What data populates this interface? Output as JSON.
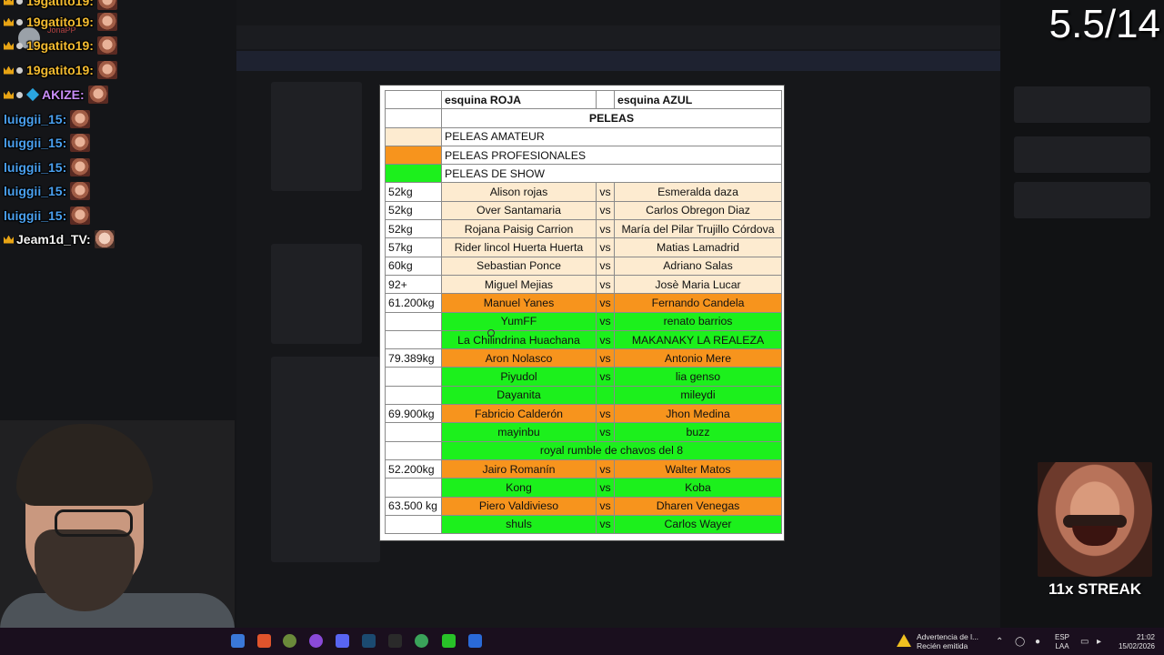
{
  "counter": "5.5/14",
  "chat": [
    {
      "user": "19gatito19:",
      "color": "gold",
      "badges": [
        "crown"
      ]
    },
    {
      "user": "19gatito19:",
      "color": "gold",
      "badges": [
        "crown",
        "dot"
      ],
      "tag": "JonaPP"
    },
    {
      "user": "19gatito19:",
      "color": "gold",
      "badges": [
        "crown",
        "dot"
      ]
    },
    {
      "user": "AKIZE:",
      "color": "purple",
      "badges": [
        "crown",
        "dot",
        "gem"
      ]
    },
    {
      "user": "luiggii_15:",
      "color": "blue",
      "badges": []
    },
    {
      "user": "luiggii_15:",
      "color": "blue",
      "badges": []
    },
    {
      "user": "luiggii_15:",
      "color": "blue",
      "badges": []
    },
    {
      "user": "luiggii_15:",
      "color": "blue",
      "badges": []
    },
    {
      "user": "luiggii_15:",
      "color": "blue",
      "badges": []
    },
    {
      "user": "Jeam1d_TV:",
      "color": "white",
      "badges": [
        "crown"
      ]
    }
  ],
  "sheet": {
    "header": {
      "red": "esquina ROJA",
      "blue": "esquina AZUL"
    },
    "title": "PELEAS",
    "legend": [
      "PELEAS AMATEUR",
      "PELEAS PROFESIONALES",
      "PELEAS DE SHOW"
    ],
    "rows": [
      {
        "w": "52kg",
        "a": "Alison rojas",
        "vs": "vs",
        "b": "Esmeralda daza",
        "type": "am"
      },
      {
        "w": "52kg",
        "a": "Over Santamaria",
        "vs": "vs",
        "b": "Carlos Obregon Diaz",
        "type": "am"
      },
      {
        "w": "52kg",
        "a": "Rojana Paisig Carrion",
        "vs": "vs",
        "b": "María del Pilar Trujillo Córdova",
        "type": "am"
      },
      {
        "w": "57kg",
        "a": "Rider lincol Huerta Huerta",
        "vs": "vs",
        "b": "Matias Lamadrid",
        "type": "am"
      },
      {
        "w": "60kg",
        "a": "Sebastian Ponce",
        "vs": "vs",
        "b": "Adriano Salas",
        "type": "am"
      },
      {
        "w": "92+",
        "a": "Miguel Mejias",
        "vs": "vs",
        "b": "Josè Maria Lucar",
        "type": "am"
      },
      {
        "w": "61.200kg",
        "a": "Manuel Yanes",
        "vs": "vs",
        "b": "Fernando Candela",
        "type": "pro"
      },
      {
        "w": "",
        "a": "YumFF",
        "vs": "vs",
        "b": "renato barrios",
        "type": "show"
      },
      {
        "w": "",
        "a": "La Chilindrina Huachana",
        "vs": "vs",
        "b": "MAKANAKY LA REALEZA",
        "type": "show"
      },
      {
        "w": "79.389kg",
        "a": "Aron Nolasco",
        "vs": "vs",
        "b": "Antonio Mere",
        "type": "pro"
      },
      {
        "w": "",
        "a": "Piyudol",
        "vs": "vs",
        "b": "lia genso",
        "type": "show"
      },
      {
        "w": "",
        "a": "Dayanita",
        "vs": "",
        "b": "mileydi",
        "type": "show"
      },
      {
        "w": "69.900kg",
        "a": "Fabricio Calderón",
        "vs": "vs",
        "b": "Jhon Medina",
        "type": "pro"
      },
      {
        "w": "",
        "a": "mayinbu",
        "vs": "vs",
        "b": "buzz",
        "type": "show"
      },
      {
        "w": "",
        "a": "royal rumble de chavos del 8",
        "vs": "",
        "b": "",
        "type": "show",
        "merged": true
      },
      {
        "w": "52.200kg",
        "a": "Jairo Romanín",
        "vs": "vs",
        "b": "Walter Matos",
        "type": "pro"
      },
      {
        "w": "",
        "a": "Kong",
        "vs": "vs",
        "b": "Koba",
        "type": "show"
      },
      {
        "w": "63.500 kg",
        "a": "Piero Valdivieso",
        "vs": "vs",
        "b": "Dharen Venegas",
        "type": "pro"
      },
      {
        "w": "",
        "a": "shuls",
        "vs": "vs",
        "b": "Carlos Wayer",
        "type": "show"
      }
    ]
  },
  "streak": "11x STREAK",
  "taskbar": {
    "notice_title": "Advertencia de l...",
    "notice_sub": "Recién emitida",
    "lang_top": "ESP",
    "lang_bottom": "LAA",
    "time": "21:02",
    "date": "15/02/2026"
  },
  "colors": {
    "amateur": "#fdebd0",
    "pro": "#f7941d",
    "show": "#1cf01c"
  }
}
